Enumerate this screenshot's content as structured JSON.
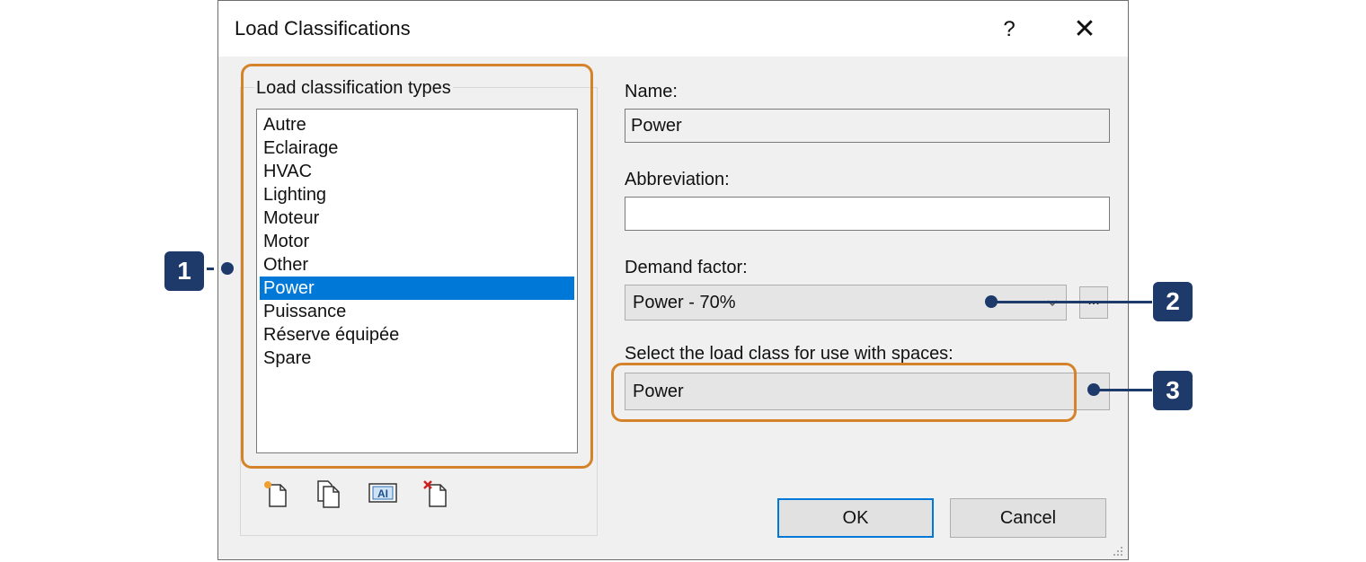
{
  "window": {
    "title": "Load Classifications",
    "help_glyph": "?",
    "close_glyph": "✕"
  },
  "group": {
    "label": "Load classification types",
    "items": [
      {
        "label": "Autre"
      },
      {
        "label": "Eclairage"
      },
      {
        "label": "HVAC"
      },
      {
        "label": "Lighting"
      },
      {
        "label": "Moteur"
      },
      {
        "label": "Motor"
      },
      {
        "label": "Other"
      },
      {
        "label": "Power",
        "selected": true
      },
      {
        "label": "Puissance"
      },
      {
        "label": "Réserve équipée"
      },
      {
        "label": "Spare"
      }
    ],
    "selected_color": "#0078d7",
    "toolbar": {
      "icons": [
        "new-icon",
        "duplicate-icon",
        "rename-icon",
        "delete-icon"
      ],
      "rename_glyph": "AI"
    }
  },
  "form": {
    "name_label": "Name:",
    "name_value": "Power",
    "abbreviation_label": "Abbreviation:",
    "abbreviation_value": "",
    "demand_label": "Demand factor:",
    "demand_value": "Power - 70%",
    "demand_more": "...",
    "space_class_label": "Select the load class for use with spaces:",
    "space_class_value": "Power"
  },
  "buttons": {
    "ok": "OK",
    "cancel": "Cancel",
    "default_border_color": "#0078d7"
  },
  "callouts": {
    "badges": [
      "1",
      "2",
      "3"
    ],
    "badge_color": "#1d3a6b",
    "highlight_color": "#d4832b"
  }
}
